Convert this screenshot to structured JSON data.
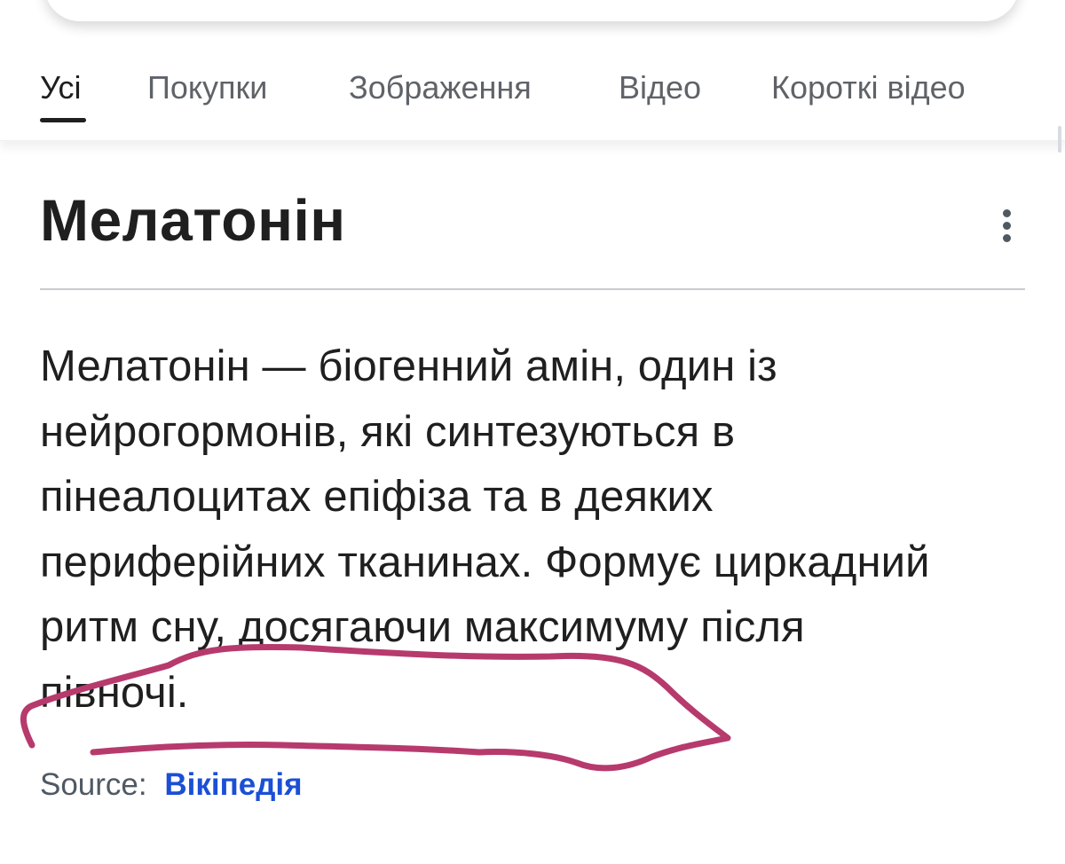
{
  "tabs": [
    {
      "label": "Усі",
      "active": true
    },
    {
      "label": "Покупки",
      "active": false
    },
    {
      "label": "Зображення",
      "active": false
    },
    {
      "label": "Відео",
      "active": false
    },
    {
      "label": "Короткі відео",
      "active": false
    }
  ],
  "knowledge_panel": {
    "title": "Мелатонін",
    "description": "Мелатонін — біогенний амін, один із нейрогормонів, які синтезуються в пінеалоцитах епіфіза та в деяких периферійних тканинах. Формує циркадний ритм сну, досягаючи максимуму після півночі.",
    "source_label": "Source:",
    "source_link": "Вікіпедія",
    "menu_icon": "more-vertical-icon"
  },
  "colors": {
    "background": "#ffffff",
    "text": "#1f1f1f",
    "muted_text": "#5f6368",
    "link": "#1a4fd6",
    "annotation_stroke": "#b73a6d"
  }
}
